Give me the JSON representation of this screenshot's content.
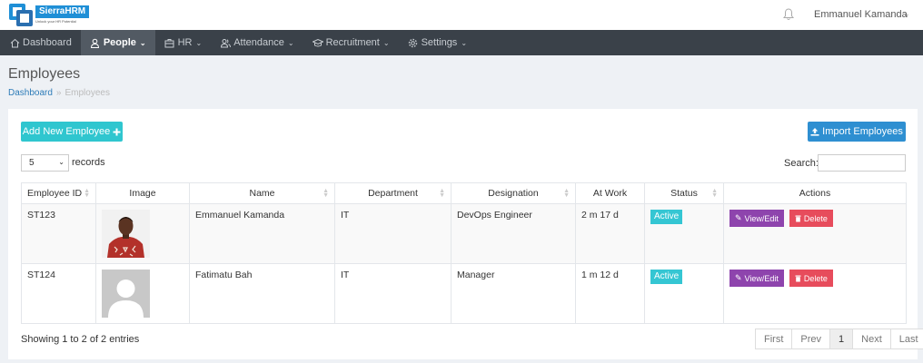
{
  "app": {
    "name": "SierraHRM",
    "tagline": "Unlock your HR Potential",
    "user": "Emmanuel Kamanda"
  },
  "nav": [
    {
      "label": "Dashboard",
      "icon": "home-icon",
      "active": false
    },
    {
      "label": "People",
      "icon": "user-icon",
      "active": true
    },
    {
      "label": "HR",
      "icon": "briefcase-icon",
      "active": false
    },
    {
      "label": "Attendance",
      "icon": "users-icon",
      "active": false
    },
    {
      "label": "Recruitment",
      "icon": "graduation-cap-icon",
      "active": false
    },
    {
      "label": "Settings",
      "icon": "gear-icon",
      "active": false
    }
  ],
  "page": {
    "title": "Employees",
    "breadcrumb_home": "Dashboard",
    "breadcrumb_sep": "»",
    "breadcrumb_current": "Employees"
  },
  "toolbar": {
    "add_label": "Add New Employee",
    "import_label": "Import Employees",
    "page_length": "5",
    "records_label": "records",
    "search_label": "Search:",
    "search_value": ""
  },
  "table": {
    "headers": [
      "Employee ID",
      "Image",
      "Name",
      "Department",
      "Designation",
      "At Work",
      "Status",
      "Actions"
    ],
    "rows": [
      {
        "id": "ST123",
        "name": "Emmanuel Kamanda",
        "department": "IT",
        "designation": "DevOps Engineer",
        "at_work": "2 m 17 d",
        "status": "Active",
        "edit_label": "View/Edit",
        "delete_label": "Delete"
      },
      {
        "id": "ST124",
        "name": "Fatimatu Bah",
        "department": "IT",
        "designation": "Manager",
        "at_work": "1 m 12 d",
        "status": "Active",
        "edit_label": "View/Edit",
        "delete_label": "Delete"
      }
    ]
  },
  "footer": {
    "info": "Showing 1 to 2 of 2 entries",
    "pager": [
      "First",
      "Prev",
      "1",
      "Next",
      "Last"
    ],
    "current_page": "1"
  },
  "colors": {
    "nav_bg": "#3a4149",
    "add_button": "#2fc6cf",
    "import_button": "#2e8fd1",
    "status_active": "#35c6d3",
    "edit_button": "#8e44ad",
    "delete_button": "#e74c5c"
  }
}
